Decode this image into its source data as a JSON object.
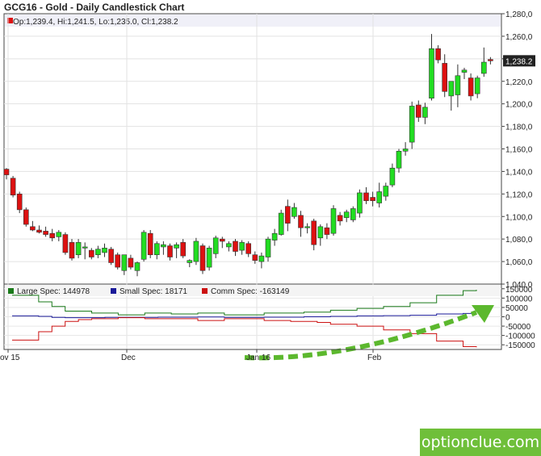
{
  "title": "GCG16 - Gold - Daily Candlestick Chart",
  "ohlc_label": "Op:1,239.4, Hi:1,241.5, Lo:1,235.0, Cl:1,238.2",
  "last_price_tag": "1,238.2",
  "watermark": "optionclue.com",
  "colors": {
    "up": "#22dd22",
    "down": "#dd1111",
    "large_spec": "#1a7a1a",
    "small_spec": "#1a1a99",
    "comm_spec": "#cc1111",
    "arrow": "#5cb82e"
  },
  "chart_data": [
    {
      "type": "candlestick",
      "title": "GCG16 - Gold - Daily Candlestick Chart",
      "y_ticks": [
        "1,280,0",
        "1,260,0",
        "1,240,0",
        "1,220,0",
        "1,200,0",
        "1,180,0",
        "1,160,0",
        "1,140,0",
        "1,120,0",
        "1,100,0",
        "1,080,0",
        "1,060,0",
        "1,040,0"
      ],
      "ylim": [
        1040,
        1280
      ],
      "x_ticks": [
        "ov 15",
        "Dec",
        "Jan 16",
        "Feb"
      ],
      "grid": true,
      "candles": [
        {
          "o": 1142,
          "h": 1143,
          "l": 1133,
          "c": 1137
        },
        {
          "o": 1134,
          "h": 1136,
          "l": 1117,
          "c": 1119
        },
        {
          "o": 1120,
          "h": 1122,
          "l": 1103,
          "c": 1106
        },
        {
          "o": 1106,
          "h": 1108,
          "l": 1091,
          "c": 1093
        },
        {
          "o": 1091,
          "h": 1096,
          "l": 1087,
          "c": 1088
        },
        {
          "o": 1088,
          "h": 1092,
          "l": 1085,
          "c": 1086
        },
        {
          "o": 1087,
          "h": 1091,
          "l": 1082,
          "c": 1084
        },
        {
          "o": 1085,
          "h": 1089,
          "l": 1078,
          "c": 1081
        },
        {
          "o": 1082,
          "h": 1088,
          "l": 1078,
          "c": 1086
        },
        {
          "o": 1084,
          "h": 1086,
          "l": 1066,
          "c": 1068
        },
        {
          "o": 1077,
          "h": 1080,
          "l": 1061,
          "c": 1063
        },
        {
          "o": 1066,
          "h": 1080,
          "l": 1063,
          "c": 1077
        },
        {
          "o": 1072,
          "h": 1077,
          "l": 1062,
          "c": 1073
        },
        {
          "o": 1070,
          "h": 1072,
          "l": 1062,
          "c": 1064
        },
        {
          "o": 1066,
          "h": 1074,
          "l": 1063,
          "c": 1071
        },
        {
          "o": 1068,
          "h": 1076,
          "l": 1064,
          "c": 1072
        },
        {
          "o": 1071,
          "h": 1073,
          "l": 1057,
          "c": 1059
        },
        {
          "o": 1066,
          "h": 1068,
          "l": 1053,
          "c": 1055
        },
        {
          "o": 1052,
          "h": 1066,
          "l": 1048,
          "c": 1066
        },
        {
          "o": 1063,
          "h": 1066,
          "l": 1053,
          "c": 1055
        },
        {
          "o": 1052,
          "h": 1060,
          "l": 1047,
          "c": 1059
        },
        {
          "o": 1062,
          "h": 1088,
          "l": 1060,
          "c": 1086
        },
        {
          "o": 1085,
          "h": 1088,
          "l": 1063,
          "c": 1066
        },
        {
          "o": 1066,
          "h": 1078,
          "l": 1062,
          "c": 1076
        },
        {
          "o": 1073,
          "h": 1078,
          "l": 1066,
          "c": 1075
        },
        {
          "o": 1074,
          "h": 1076,
          "l": 1061,
          "c": 1064
        },
        {
          "o": 1072,
          "h": 1077,
          "l": 1063,
          "c": 1075
        },
        {
          "o": 1077,
          "h": 1080,
          "l": 1063,
          "c": 1065
        },
        {
          "o": 1059,
          "h": 1062,
          "l": 1055,
          "c": 1061
        },
        {
          "o": 1060,
          "h": 1081,
          "l": 1057,
          "c": 1078
        },
        {
          "o": 1074,
          "h": 1076,
          "l": 1049,
          "c": 1052
        },
        {
          "o": 1055,
          "h": 1074,
          "l": 1052,
          "c": 1072
        },
        {
          "o": 1067,
          "h": 1083,
          "l": 1063,
          "c": 1081
        },
        {
          "o": 1080,
          "h": 1082,
          "l": 1072,
          "c": 1078
        },
        {
          "o": 1073,
          "h": 1078,
          "l": 1069,
          "c": 1076
        },
        {
          "o": 1078,
          "h": 1080,
          "l": 1065,
          "c": 1069
        },
        {
          "o": 1070,
          "h": 1079,
          "l": 1066,
          "c": 1077
        },
        {
          "o": 1076,
          "h": 1078,
          "l": 1064,
          "c": 1067
        },
        {
          "o": 1066,
          "h": 1069,
          "l": 1058,
          "c": 1061
        },
        {
          "o": 1060,
          "h": 1068,
          "l": 1054,
          "c": 1065
        },
        {
          "o": 1064,
          "h": 1082,
          "l": 1060,
          "c": 1080
        },
        {
          "o": 1079,
          "h": 1089,
          "l": 1074,
          "c": 1085
        },
        {
          "o": 1084,
          "h": 1106,
          "l": 1083,
          "c": 1103
        },
        {
          "o": 1109,
          "h": 1115,
          "l": 1087,
          "c": 1094
        },
        {
          "o": 1100,
          "h": 1112,
          "l": 1098,
          "c": 1108
        },
        {
          "o": 1101,
          "h": 1105,
          "l": 1082,
          "c": 1090
        },
        {
          "o": 1090,
          "h": 1094,
          "l": 1085,
          "c": 1091
        },
        {
          "o": 1096,
          "h": 1098,
          "l": 1070,
          "c": 1075
        },
        {
          "o": 1081,
          "h": 1093,
          "l": 1074,
          "c": 1091
        },
        {
          "o": 1090,
          "h": 1094,
          "l": 1080,
          "c": 1084
        },
        {
          "o": 1085,
          "h": 1110,
          "l": 1083,
          "c": 1107
        },
        {
          "o": 1101,
          "h": 1104,
          "l": 1092,
          "c": 1096
        },
        {
          "o": 1099,
          "h": 1106,
          "l": 1095,
          "c": 1104
        },
        {
          "o": 1097,
          "h": 1109,
          "l": 1095,
          "c": 1107
        },
        {
          "o": 1103,
          "h": 1124,
          "l": 1099,
          "c": 1121
        },
        {
          "o": 1121,
          "h": 1126,
          "l": 1111,
          "c": 1114
        },
        {
          "o": 1117,
          "h": 1122,
          "l": 1109,
          "c": 1114
        },
        {
          "o": 1112,
          "h": 1130,
          "l": 1108,
          "c": 1122
        },
        {
          "o": 1118,
          "h": 1130,
          "l": 1114,
          "c": 1127
        },
        {
          "o": 1128,
          "h": 1147,
          "l": 1126,
          "c": 1143
        },
        {
          "o": 1143,
          "h": 1160,
          "l": 1139,
          "c": 1158
        },
        {
          "o": 1158,
          "h": 1166,
          "l": 1154,
          "c": 1160
        },
        {
          "o": 1166,
          "h": 1202,
          "l": 1160,
          "c": 1198
        },
        {
          "o": 1199,
          "h": 1203,
          "l": 1184,
          "c": 1188
        },
        {
          "o": 1188,
          "h": 1201,
          "l": 1182,
          "c": 1197
        },
        {
          "o": 1205,
          "h": 1262,
          "l": 1203,
          "c": 1249
        },
        {
          "o": 1249,
          "h": 1252,
          "l": 1236,
          "c": 1239
        },
        {
          "o": 1236,
          "h": 1244,
          "l": 1206,
          "c": 1211
        },
        {
          "o": 1207,
          "h": 1220,
          "l": 1194,
          "c": 1220
        },
        {
          "o": 1208,
          "h": 1235,
          "l": 1197,
          "c": 1225
        },
        {
          "o": 1228,
          "h": 1232,
          "l": 1222,
          "c": 1230
        },
        {
          "o": 1223,
          "h": 1227,
          "l": 1203,
          "c": 1207
        },
        {
          "o": 1209,
          "h": 1225,
          "l": 1205,
          "c": 1223
        },
        {
          "o": 1227,
          "h": 1250,
          "l": 1224,
          "c": 1237
        },
        {
          "o": 1239.4,
          "h": 1241.5,
          "l": 1235.0,
          "c": 1238.2
        }
      ]
    },
    {
      "type": "line",
      "legend": [
        "Large Spec: 144978",
        "Small Spec: 18171",
        "Comm Spec: -163149"
      ],
      "y_ticks": [
        "150000",
        "100000",
        "50000",
        "0",
        "-50000",
        "-100000",
        "-150000"
      ],
      "ylim": [
        -175000,
        175000
      ],
      "x_ticks": [
        "ov 15",
        "Dec",
        "Jan 16",
        "Feb"
      ],
      "series": [
        {
          "name": "Large Spec",
          "values": [
            115000,
            115000,
            80000,
            55000,
            30000,
            30000,
            20000,
            20000,
            10000,
            10000,
            20000,
            20000,
            15000,
            15000,
            20000,
            20000,
            10000,
            10000,
            10000,
            20000,
            20000,
            20000,
            25000,
            25000,
            35000,
            35000,
            45000,
            45000,
            55000,
            55000,
            75000,
            75000,
            115000,
            115000,
            140000,
            145000
          ]
        },
        {
          "name": "Small Spec",
          "values": [
            5000,
            5000,
            2000,
            -3000,
            -5000,
            -5000,
            -5000,
            -3000,
            -3000,
            -3000,
            -3000,
            -2000,
            -2000,
            -2000,
            -1000,
            -1000,
            -3000,
            -3000,
            -3000,
            -2000,
            -2000,
            -2000,
            0,
            0,
            2000,
            2000,
            5000,
            5000,
            6000,
            6000,
            8000,
            8000,
            15000,
            15000,
            18000,
            18171
          ]
        },
        {
          "name": "Comm Spec",
          "values": [
            -125000,
            -125000,
            -80000,
            -50000,
            -25000,
            -15000,
            -10000,
            -10000,
            -5000,
            -5000,
            -10000,
            -10000,
            -10000,
            -10000,
            -20000,
            -20000,
            -10000,
            -10000,
            -10000,
            -20000,
            -20000,
            -25000,
            -25000,
            -30000,
            -40000,
            -40000,
            -50000,
            -50000,
            -70000,
            -70000,
            -90000,
            -90000,
            -130000,
            -130000,
            -160000,
            -163149
          ]
        }
      ]
    }
  ]
}
